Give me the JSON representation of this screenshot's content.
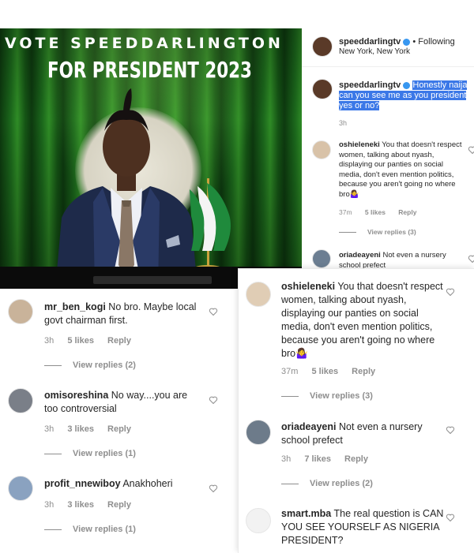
{
  "poster": {
    "line1": "VOTE SPEEDDARLINGTON",
    "line2": "FOR PRESIDENT 2023"
  },
  "post_header": {
    "username": "speeddarlingtv",
    "following": "• Following",
    "location": "New York, New York"
  },
  "caption": {
    "username": "speeddarlingtv",
    "text": "Honestly naija can you see me as you president yes or no?",
    "time": "3h"
  },
  "right_comments": [
    {
      "username": "oshieleneki",
      "text": "You that doesn't respect women, talking about nyash, displaying our panties on social media, don't even mention politics, because you aren't going no where bro🤷‍♀️",
      "time": "37m",
      "likes": "5 likes",
      "reply": "Reply",
      "view_replies": "View replies (3)"
    },
    {
      "username": "oriadeayeni",
      "text": "Not even a nursery school prefect"
    }
  ],
  "left_comments": [
    {
      "username": "mr_ben_kogi",
      "text": "No bro. Maybe local govt chairman first.",
      "time": "3h",
      "likes": "5 likes",
      "reply": "Reply",
      "view_replies": "View replies (2)"
    },
    {
      "username": "omisoreshina",
      "text": "No way....you are too controversial",
      "time": "3h",
      "likes": "3 likes",
      "reply": "Reply",
      "view_replies": "View replies (1)"
    },
    {
      "username": "profit_nnewiboy",
      "text": "Anakhoheri",
      "time": "3h",
      "likes": "3 likes",
      "reply": "Reply",
      "view_replies": "View replies (1)"
    }
  ],
  "overlay_comments": [
    {
      "username": "oshieleneki",
      "text": "You that doesn't respect women, talking about nyash, displaying our panties on social media, don't even mention politics, because you aren't going no where bro🤷‍♀️",
      "time": "37m",
      "likes": "5 likes",
      "reply": "Reply",
      "view_replies": "View replies (3)"
    },
    {
      "username": "oriadeayeni",
      "text": "Not even a nursery school prefect",
      "time": "3h",
      "likes": "7 likes",
      "reply": "Reply",
      "view_replies": "View replies (2)"
    },
    {
      "username": "smart.mba",
      "text": "The real question is CAN YOU SEE YOURSELF AS NIGERIA PRESIDENT?"
    }
  ],
  "colors": {
    "verified": "#3897f0",
    "highlight": "#3b78e7",
    "muted": "#8e8e8e",
    "poster_green": "#1c6a1c"
  },
  "icons": {
    "like": "heart-outline-icon",
    "verified": "verified-badge-icon",
    "flag": "nigeria-flag"
  }
}
